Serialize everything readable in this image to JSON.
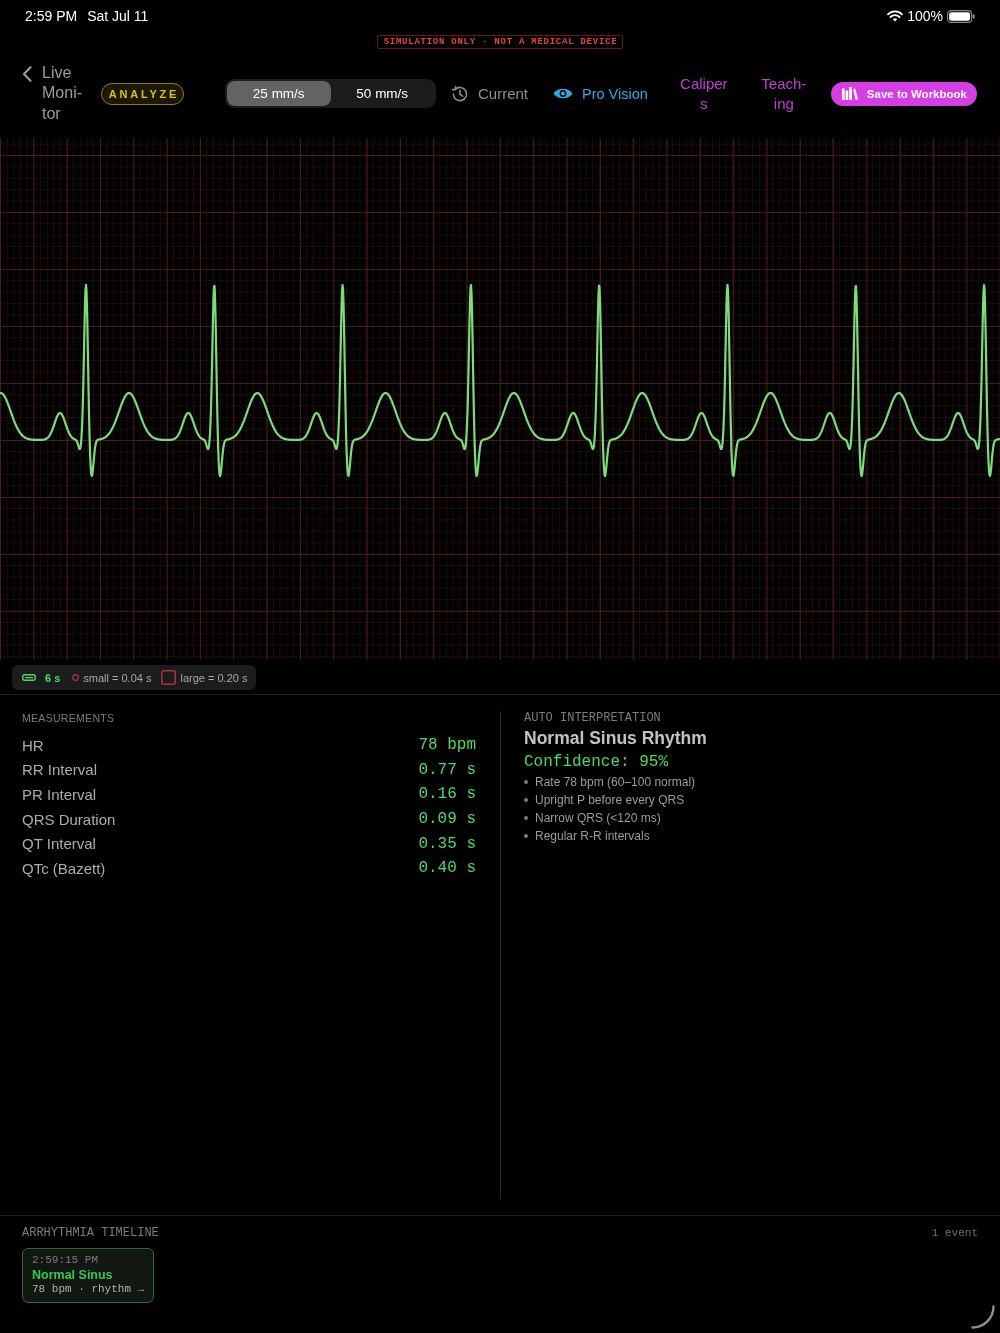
{
  "status_bar": {
    "time": "2:59 PM",
    "date": "Sat Jul 11",
    "battery": "100%"
  },
  "banner": "SIMULATION ONLY · NOT A MEDICAL DEVICE",
  "toolbar": {
    "back": "Live Moni-tor",
    "analyze": "ANALYZE",
    "speeds": [
      {
        "label": "25 mm/s",
        "selected": true
      },
      {
        "label": "50 mm/s",
        "selected": false
      }
    ],
    "current": "Current",
    "pro_vision": "Pro Vision",
    "calipers": "Calipers",
    "teaching": "Teach-ing",
    "save": "Save to Workbook"
  },
  "legend": {
    "duration": "6 s",
    "small": "small = 0.04 s",
    "large": "large = 0.20 s"
  },
  "measurements": {
    "title": "MEASUREMENTS",
    "rows": [
      {
        "label": "HR",
        "value": "78 bpm"
      },
      {
        "label": "RR Interval",
        "value": "0.77 s"
      },
      {
        "label": "PR Interval",
        "value": "0.16 s"
      },
      {
        "label": "QRS Duration",
        "value": "0.09 s"
      },
      {
        "label": "QT Interval",
        "value": "0.35 s"
      },
      {
        "label": "QTc (Bazett)",
        "value": "0.40 s"
      }
    ]
  },
  "interpretation": {
    "title": "AUTO INTERPRETATION",
    "rhythm": "Normal Sinus Rhythm",
    "confidence": "Confidence: 95%",
    "findings": [
      "Rate 78 bpm (60–100 normal)",
      "Upright P before every QRS",
      "Narrow QRS (<120 ms)",
      "Regular R-R intervals"
    ]
  },
  "timeline": {
    "title": "ARRHYTHMIA TIMELINE",
    "count": "1 event",
    "events": [
      {
        "time": "2:59:15 PM",
        "name": "Normal Sinus",
        "detail": "78 bpm · rhythm →"
      }
    ]
  }
}
